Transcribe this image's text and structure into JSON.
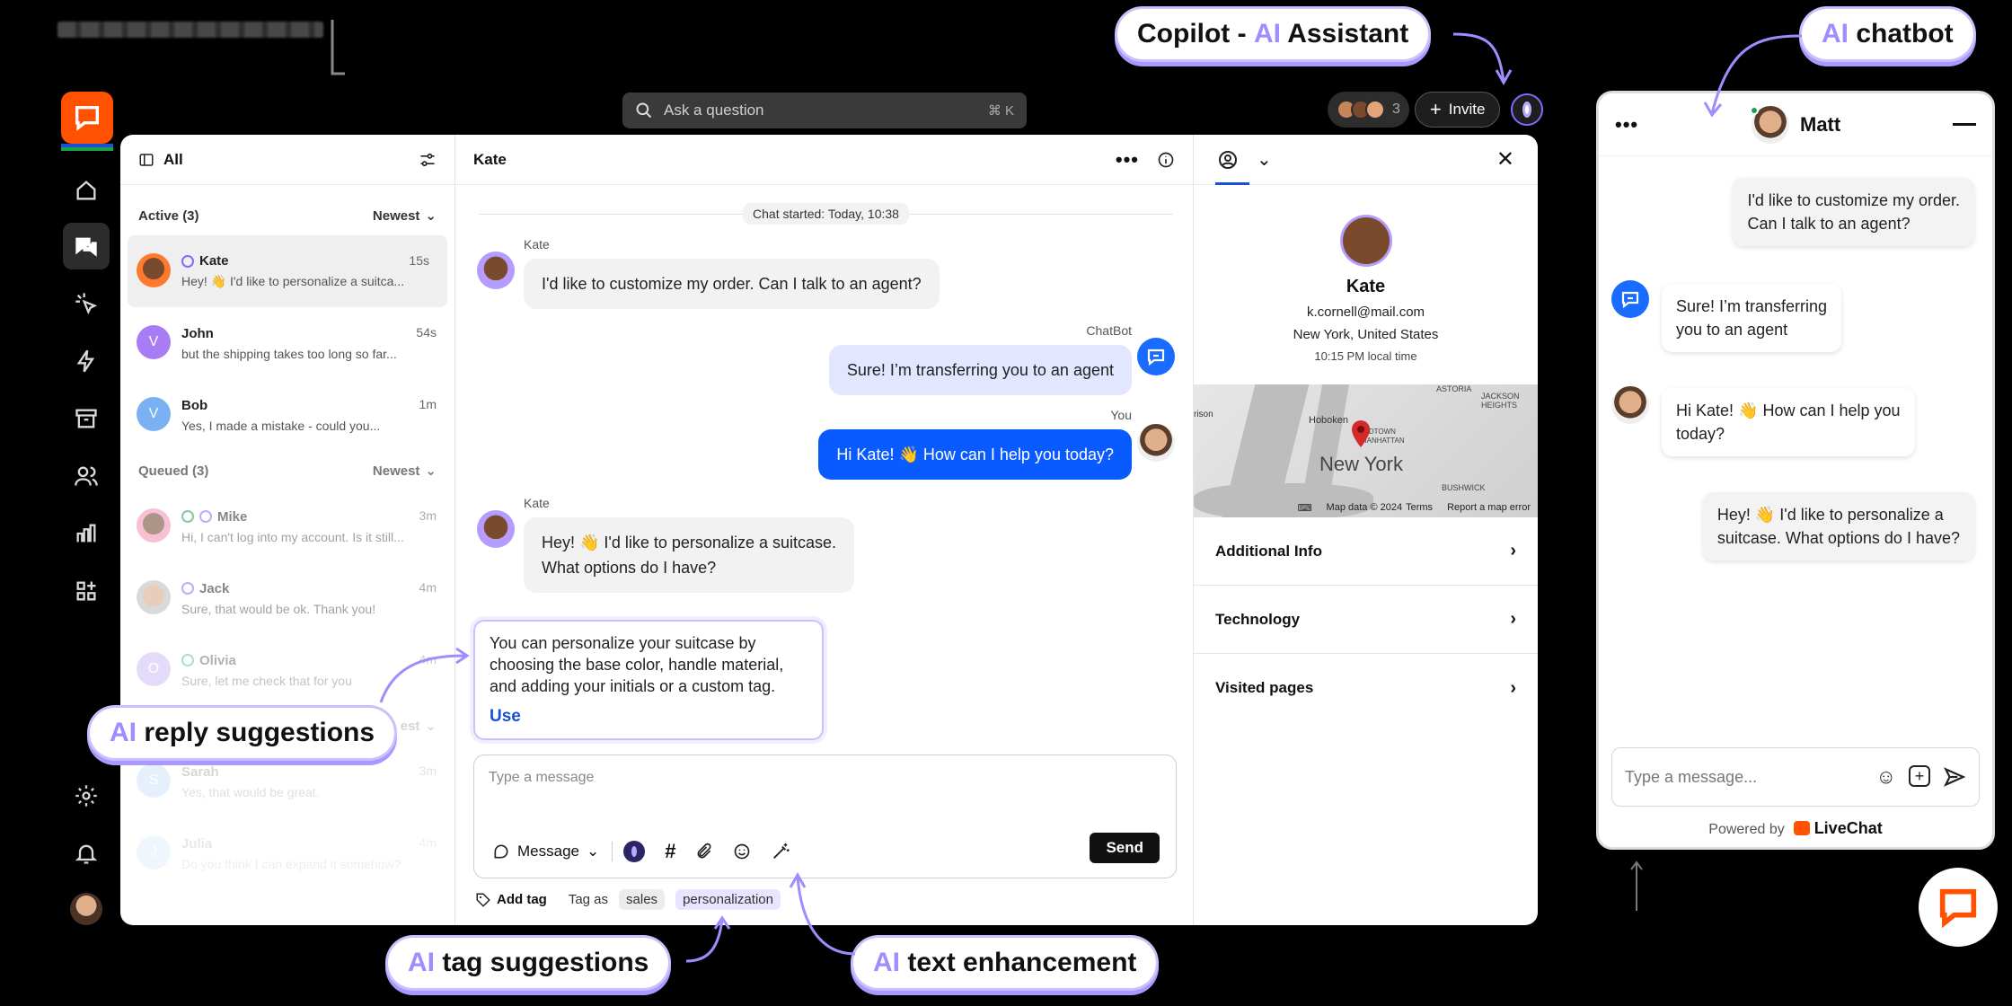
{
  "search": {
    "placeholder": "Ask a question",
    "shortcut": "⌘ K"
  },
  "topbar": {
    "agent_count": "3",
    "invite_label": "Invite"
  },
  "rail": {
    "icons": [
      "home-icon",
      "chats-icon",
      "cursor-click-icon",
      "lightning-icon",
      "archive-icon",
      "users-icon",
      "reports-icon",
      "apps-icon",
      "settings-icon",
      "bell-icon"
    ]
  },
  "list": {
    "title": "All",
    "active": {
      "label": "Active (3)",
      "sort": "Newest"
    },
    "queued": {
      "label": "Queued (3)",
      "sort": "Newest"
    },
    "active_items": [
      {
        "name": "Kate",
        "time": "15s",
        "msg": "Hey! 👋 I'd like to personalize a suitca..."
      },
      {
        "name": "John",
        "time": "54s",
        "msg": "but the shipping takes too long so far...",
        "initial": "V"
      },
      {
        "name": "Bob",
        "time": "1m",
        "msg": "Yes, I made a mistake - could you...",
        "initial": "V"
      }
    ],
    "queued_items": [
      {
        "name": "Mike",
        "time": "3m",
        "msg": "Hi, I can't log into my account. Is it still..."
      },
      {
        "name": "Jack",
        "time": "4m",
        "msg": "Sure, that would be ok. Thank you!"
      },
      {
        "name": "Olivia",
        "time": "4m",
        "msg": "Sure, let me check that for you",
        "initial": "O"
      }
    ],
    "faded_items": [
      {
        "name": "Sarah",
        "time": "3m",
        "msg": "Yes, that would be great.",
        "initial": "S"
      },
      {
        "name": "Julia",
        "time": "4m",
        "msg": "Do you think I can expand it somehow?",
        "initial": "J"
      }
    ],
    "faded_section": "est"
  },
  "chat": {
    "title": "Kate",
    "started": "Chat started: Today, 10:38",
    "msg1": {
      "author": "Kate",
      "text": "I'd like to customize my order. Can I talk to an agent?"
    },
    "msg2": {
      "author": "ChatBot",
      "text": "Sure! I’m transferring you to an agent"
    },
    "msg3": {
      "author": "You",
      "text": "Hi Kate! 👋 How can I help you today?"
    },
    "msg4": {
      "author": "Kate",
      "line1": "Hey! 👋  I'd like to personalize a suitcase.",
      "line2": "What options do I have?"
    },
    "suggestion": {
      "text": "You can personalize your suitcase by choosing the base color, handle material, and adding your initials or a custom tag.",
      "use": "Use"
    },
    "composer": {
      "placeholder": "Type a message",
      "mode": "Message",
      "send": "Send"
    },
    "tags": {
      "add": "Add tag",
      "tag_as": "Tag as",
      "chips": [
        "sales",
        "personalization"
      ]
    }
  },
  "details": {
    "name": "Kate",
    "email": "k.cornell@mail.com",
    "location": "New York, United States",
    "local_time": "10:15 PM local time",
    "map": {
      "city": "New York",
      "labels": [
        "Hoboken",
        "MIDTOWN MANHATTAN",
        "ASTORIA",
        "JACKSON HEIGHTS",
        "BUSHWICK",
        "rison"
      ],
      "data": "Map data © 2024",
      "terms": "Terms",
      "report": "Report a map error"
    },
    "sections": [
      "Additional Info",
      "Technology",
      "Visited pages"
    ]
  },
  "widget": {
    "agent": "Matt",
    "msgs": [
      {
        "line1": "I'd like to customize my order.",
        "line2": "Can I talk to an agent?"
      },
      {
        "line1": "Sure! I’m transferring",
        "line2": "you to an agent"
      },
      {
        "line1": "Hi Kate! 👋 How can I help you",
        "line2": "today?"
      },
      {
        "line1": "Hey! 👋  I'd like to personalize a",
        "line2": "suitcase. What options do I have?"
      }
    ],
    "input_placeholder": "Type a message...",
    "powered_by": "Powered by",
    "brand": "LiveChat"
  },
  "callouts": {
    "copilot": {
      "ai": "AI",
      "prefix": "Copilot - ",
      "suffix": " Assistant"
    },
    "chatbot": {
      "ai": "AI",
      "suffix": " chatbot"
    },
    "reply": {
      "ai": "AI",
      "suffix": " reply suggestions"
    },
    "tags": {
      "ai": "AI",
      "suffix": " tag suggestions"
    },
    "text": {
      "ai": "AI",
      "suffix": " text enhancement"
    }
  },
  "colors": {
    "brand_orange": "#ff5100",
    "accent_blue": "#0a5bff",
    "ai_purple": "#9f8cff"
  }
}
